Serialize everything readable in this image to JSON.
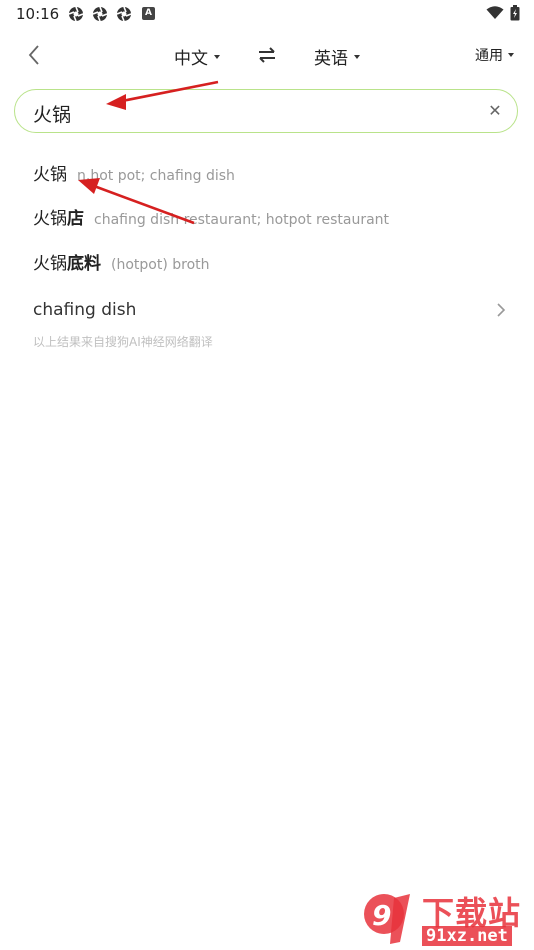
{
  "status": {
    "time": "10:16",
    "notif_letter": "A"
  },
  "header": {
    "source_lang": "中文",
    "target_lang": "英语",
    "mode": "通用"
  },
  "search": {
    "value": "火锅"
  },
  "results": [
    {
      "term": "火锅",
      "definition": "n.hot pot; chafing dish"
    },
    {
      "term_base": "火锅",
      "term_extra": "店",
      "definition": "chafing dish restaurant; hotpot restaurant"
    },
    {
      "term_base": "火锅",
      "term_extra": "底料",
      "definition": "(hotpot) broth"
    }
  ],
  "ai_translation": {
    "text": "chafing dish",
    "note": "以上结果来自搜狗AI神经网络翻译"
  },
  "watermark": {
    "brand": "下载站",
    "site": "91xz.net",
    "logo_text": "9f"
  },
  "colors": {
    "accent_border": "#b9e38a",
    "annotation_arrow": "#d62020",
    "watermark_red": "#e8323c"
  }
}
